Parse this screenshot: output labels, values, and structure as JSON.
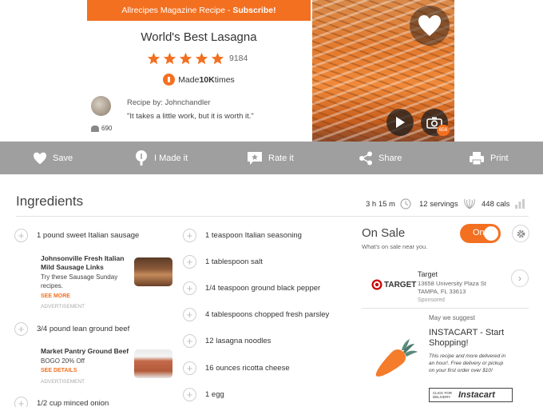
{
  "banner": {
    "prefix": "Allrecipes Magazine Recipe - ",
    "link": "Subscribe!"
  },
  "recipe": {
    "title": "World's Best Lasagna",
    "rating": 5,
    "rating_count": "9184",
    "made_prefix": "Made ",
    "made_count": "10K",
    "made_suffix": " times",
    "recipe_by_label": "Recipe by: ",
    "author": "Johnchandler",
    "quote": "\"It takes a little work, but it is worth it.\"",
    "followers": "690",
    "photo_count": "656"
  },
  "actions": [
    {
      "label": "Save",
      "icon": "heart-icon"
    },
    {
      "label": "I Made it",
      "icon": "chef-hat-icon"
    },
    {
      "label": "Rate it",
      "icon": "rate-icon"
    },
    {
      "label": "Share",
      "icon": "share-icon"
    },
    {
      "label": "Print",
      "icon": "printer-icon"
    }
  ],
  "ingredients_header": {
    "title": "Ingredients",
    "time": "3 h 15 m",
    "servings": "12 servings",
    "calories": "448 cals"
  },
  "ingredients_col1": [
    "1 pound sweet Italian sausage",
    "3/4 pound lean ground beef",
    "1/2 cup minced onion"
  ],
  "ingredients_col2": [
    "1 teaspoon Italian seasoning",
    "1 tablespoon salt",
    "1/4 teaspoon ground black pepper",
    "4 tablespoons chopped fresh parsley",
    "12 lasagna noodles",
    "16 ounces ricotta cheese",
    "1 egg"
  ],
  "ads": {
    "sausage": {
      "title_line1": "Johnsonville Fresh Italian",
      "title_line2": "Mild Sausage Links",
      "text_line1": "Try these Sausage Sunday",
      "text_line2": "recipes.",
      "link": "SEE MORE",
      "label": "ADVERTISEMENT"
    },
    "beef": {
      "title": "Market Pantry Ground Beef",
      "text": "BOGO 20% Off",
      "link": "SEE DETAILS",
      "label": "ADVERTISEMENT"
    }
  },
  "on_sale": {
    "title": "On Sale",
    "subtitle": "What's on sale near you.",
    "toggle": "On"
  },
  "store": {
    "logo_text": "TARGET",
    "name": "Target",
    "address1": "13658 University Plaza St",
    "address2": "TAMPA, FL 33613",
    "sponsored": "Sponsored"
  },
  "instacart": {
    "may_suggest": "May we suggest",
    "title_line1": "INSTACART - Start",
    "title_line2": "Shopping!",
    "text": "This recipe and more delivered in an hour!. Free delivery or pickup on your first order over $10!",
    "button_small": "CLICK FOR DELIVERY",
    "button_logo": "Instacart"
  },
  "colors": {
    "accent": "#f37021",
    "bar": "#9f9f9f"
  }
}
